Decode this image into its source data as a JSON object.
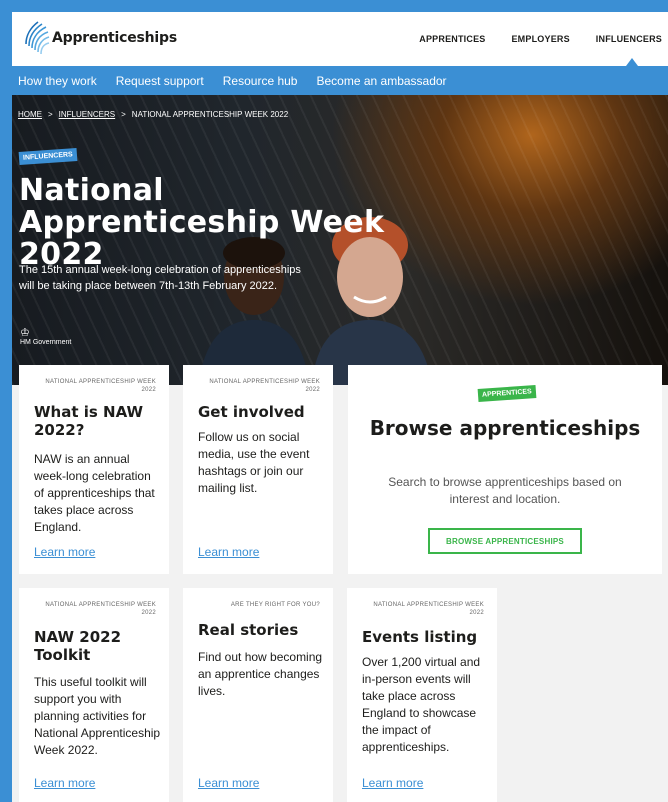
{
  "logo": {
    "text": "Apprenticeships"
  },
  "topnav": {
    "items": [
      "APPRENTICES",
      "EMPLOYERS",
      "INFLUENCERS"
    ]
  },
  "subnav": {
    "items": [
      "How they work",
      "Request support",
      "Resource hub",
      "Become an ambassador"
    ]
  },
  "breadcrumb": {
    "home": "HOME",
    "sep": ">",
    "influencers": "INFLUENCERS",
    "current": "NATIONAL APPRENTICESHIP WEEK 2022"
  },
  "hero": {
    "badge": "INFLUENCERS",
    "title": "National Apprenticeship Week 2022",
    "subtitle": "The 15th annual week-long celebration of apprenticeships will be taking place between 7th-13th February 2022.",
    "gov_crest": "♔",
    "gov_text": "HM Government"
  },
  "cards": [
    {
      "kicker": "NATIONAL APPRENTICESHIP WEEK 2022",
      "title": "What is NAW 2022?",
      "body": "NAW is an annual week-long celebration of apprenticeships that takes place across England.",
      "link": "Learn more"
    },
    {
      "kicker": "NATIONAL APPRENTICESHIP WEEK 2022",
      "title": "Get involved",
      "body": "Follow us on social media, use the event hashtags or join our mailing list.",
      "link": "Learn more"
    },
    {
      "kicker": "NATIONAL APPRENTICESHIP WEEK 2022",
      "title": "NAW 2022 Toolkit",
      "body": "This useful toolkit will support you with planning activities for National Apprenticeship Week 2022.",
      "link": "Learn more"
    },
    {
      "kicker": "ARE THEY RIGHT FOR YOU?",
      "title": "Real stories",
      "body": "Find out how becoming an apprentice changes lives.",
      "link": "Learn more"
    },
    {
      "kicker": "NATIONAL APPRENTICESHIP WEEK 2022",
      "title": "Events listing",
      "body": "Over 1,200 virtual and in-person events will take place across England to showcase the impact of apprenticeships.",
      "link": "Learn more"
    }
  ],
  "browse": {
    "badge": "APPRENTICES",
    "title": "Browse apprenticeships",
    "subtitle": "Search to browse apprenticeships based on interest and location.",
    "button": "BROWSE APPRENTICESHIPS"
  },
  "colors": {
    "brand_blue": "#3b8fd4",
    "green": "#3ab54a"
  }
}
